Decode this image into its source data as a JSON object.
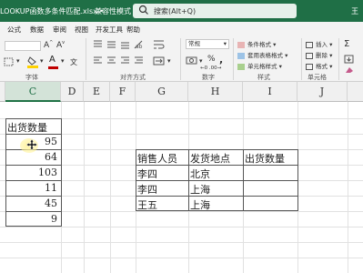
{
  "titlebar": {
    "file_name": "LOOKUP函数多条件匹配.xlsx",
    "dot": "•",
    "compat_mode": "兼容性模式",
    "search_placeholder": "搜索(Alt+Q)",
    "user": "王"
  },
  "menu": [
    "公式",
    "数据",
    "审阅",
    "视图",
    "开发工具",
    "帮助"
  ],
  "ribbon": {
    "groups": [
      "字体",
      "对齐方式",
      "数字",
      "样式",
      "单元格"
    ],
    "number_format": "常规",
    "font_color_letter": "A",
    "percent": "%",
    "thousands": ",",
    "styles": [
      "条件格式",
      "套用表格格式",
      "单元格样式"
    ],
    "cells": [
      "插入",
      "删除",
      "格式"
    ],
    "colors": {
      "font_underline": "#c00000",
      "fill_underline": "#ffd200",
      "accent": "#217346"
    }
  },
  "columns": [
    "C",
    "D",
    "E",
    "F",
    "G",
    "H",
    "I",
    "J"
  ],
  "selected_column": "C",
  "sheet": {
    "header": "出货数量",
    "values": [
      "95",
      "64",
      "103",
      "11",
      "45",
      "9"
    ],
    "lookup_headers": [
      "销售人员",
      "发货地点",
      "出货数量"
    ],
    "lookup_rows": [
      [
        "李四",
        "北京",
        ""
      ],
      [
        "李四",
        "上海",
        ""
      ],
      [
        "王五",
        "上海",
        ""
      ]
    ]
  }
}
